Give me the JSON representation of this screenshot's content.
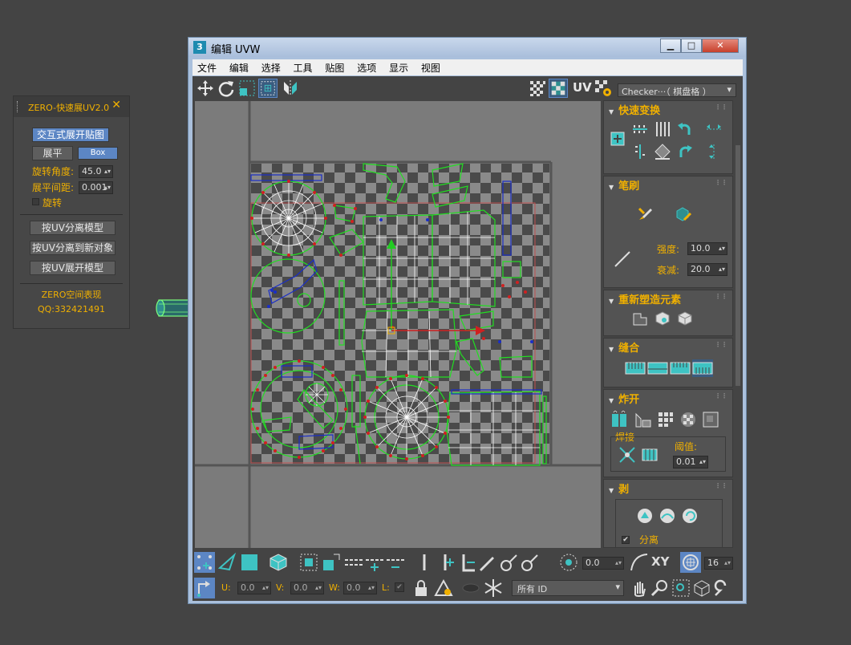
{
  "zero_panel": {
    "title": "ZERO-快速展UV2.0",
    "close": "✕",
    "btn_interactive": "交互式展开贴图",
    "btn_flatten": "展平",
    "btn_box": "Box",
    "rotation_angle_label": "旋转角度:",
    "rotation_angle_value": "45.0",
    "flatten_spacing_label": "展平间距:",
    "flatten_spacing_value": "0.001",
    "rotate_checkbox_label": "旋转",
    "btn_split_model": "按UV分离模型",
    "btn_split_new": "按UV分离到新对象",
    "btn_unwrap_model": "按UV展开模型",
    "credit": "ZERO空间表现",
    "qq": "QQ:332421491"
  },
  "window": {
    "app_icon": "3",
    "title": "编辑 UVW",
    "minimize": "▁",
    "maximize": "□",
    "close": "✕"
  },
  "menu": [
    "文件",
    "编辑",
    "选择",
    "工具",
    "贴图",
    "选项",
    "显示",
    "视图"
  ],
  "toolbar": {
    "uv_label": "UV",
    "checker_value": "Checker···（ 棋盘格 ）"
  },
  "rollouts": {
    "quick_transform": "快速变换",
    "brush": "笔刷",
    "strength_label": "强度:",
    "strength_value": "10.0",
    "falloff_label": "衰减:",
    "falloff_value": "20.0",
    "reshape": "重新塑造元素",
    "stitch": "缝合",
    "explode": "炸开",
    "weld": "焊接",
    "threshold_label": "阈值:",
    "threshold_value": "0.01",
    "peel": "剥",
    "separate_label": "分离"
  },
  "bottom": {
    "rotation_value": "0.0",
    "xy_label": "XY",
    "grid_value": "16",
    "u_label": "U:",
    "u_value": "0.0",
    "v_label": "V:",
    "v_value": "0.0",
    "w_label": "W:",
    "w_value": "0.0",
    "l_label": "L:",
    "id_dropdown": "所有 ID"
  },
  "colors": {
    "accent_orange": "#f0b000",
    "active_blue": "#5c86c4",
    "uv_green": "#22cc22",
    "uv_blue": "#1a2ec8",
    "vertex_red": "#d02020"
  }
}
